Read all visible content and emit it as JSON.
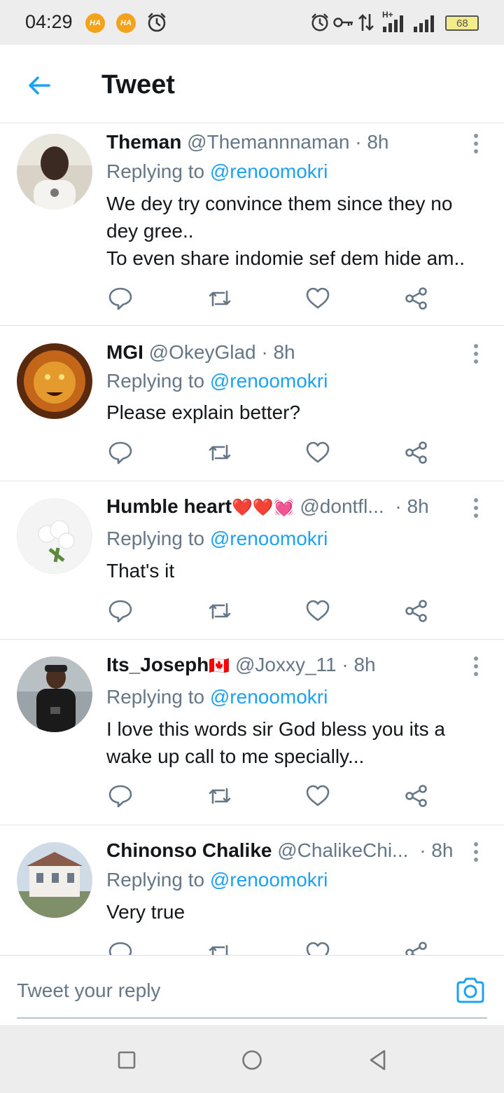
{
  "status_bar": {
    "time": "04:29",
    "app_badge_1": "HA",
    "app_badge_2": "HA",
    "network_label": "H+",
    "battery": "68",
    "icons": [
      "alarm-icon",
      "alarm-icon",
      "key-icon",
      "data-arrows-icon",
      "signal-icon",
      "signal-icon",
      "battery-icon"
    ]
  },
  "header": {
    "title": "Tweet",
    "back_icon": "arrow-left-icon"
  },
  "tweets": [
    {
      "name": "Theman",
      "handle": "@Themannnaman",
      "time": "· 8h",
      "reply_prefix": "Replying to",
      "reply_to": "@renoomokri",
      "body": [
        "We dey try convince them since they no",
        "dey gree..",
        "To even share indomie sef dem hide am.."
      ]
    },
    {
      "name": "MGI",
      "handle": "@OkeyGlad",
      "time": "· 8h",
      "reply_prefix": "Replying to",
      "reply_to": "@renoomokri",
      "body": [
        "Please explain better?"
      ]
    },
    {
      "name": "Humble heart",
      "name_emoji": "❤️❤️💓",
      "handle": "@dontfl...",
      "time": "· 8h",
      "reply_prefix": "Replying to",
      "reply_to": "@renoomokri",
      "body": [
        "That's it"
      ]
    },
    {
      "name": "Its_Joseph",
      "name_emoji": "🇨🇦",
      "handle": "@Joxxy_11",
      "time": "· 8h",
      "reply_prefix": "Replying to",
      "reply_to": "@renoomokri",
      "body": [
        "I love this words sir God bless you its a",
        "wake up call to me specially..."
      ]
    },
    {
      "name": "Chinonso Chalike",
      "handle": "@ChalikeChi...",
      "time": "· 8h",
      "reply_prefix": "Replying to",
      "reply_to": "@renoomokri",
      "body": [
        "Very true"
      ]
    }
  ],
  "composer": {
    "placeholder": "Tweet your reply",
    "camera_icon": "camera-icon"
  },
  "colors": {
    "accent": "#1da1f2",
    "secondary_text": "#657786",
    "divider": "#dfe3e6",
    "system_bar": "#ededed"
  }
}
